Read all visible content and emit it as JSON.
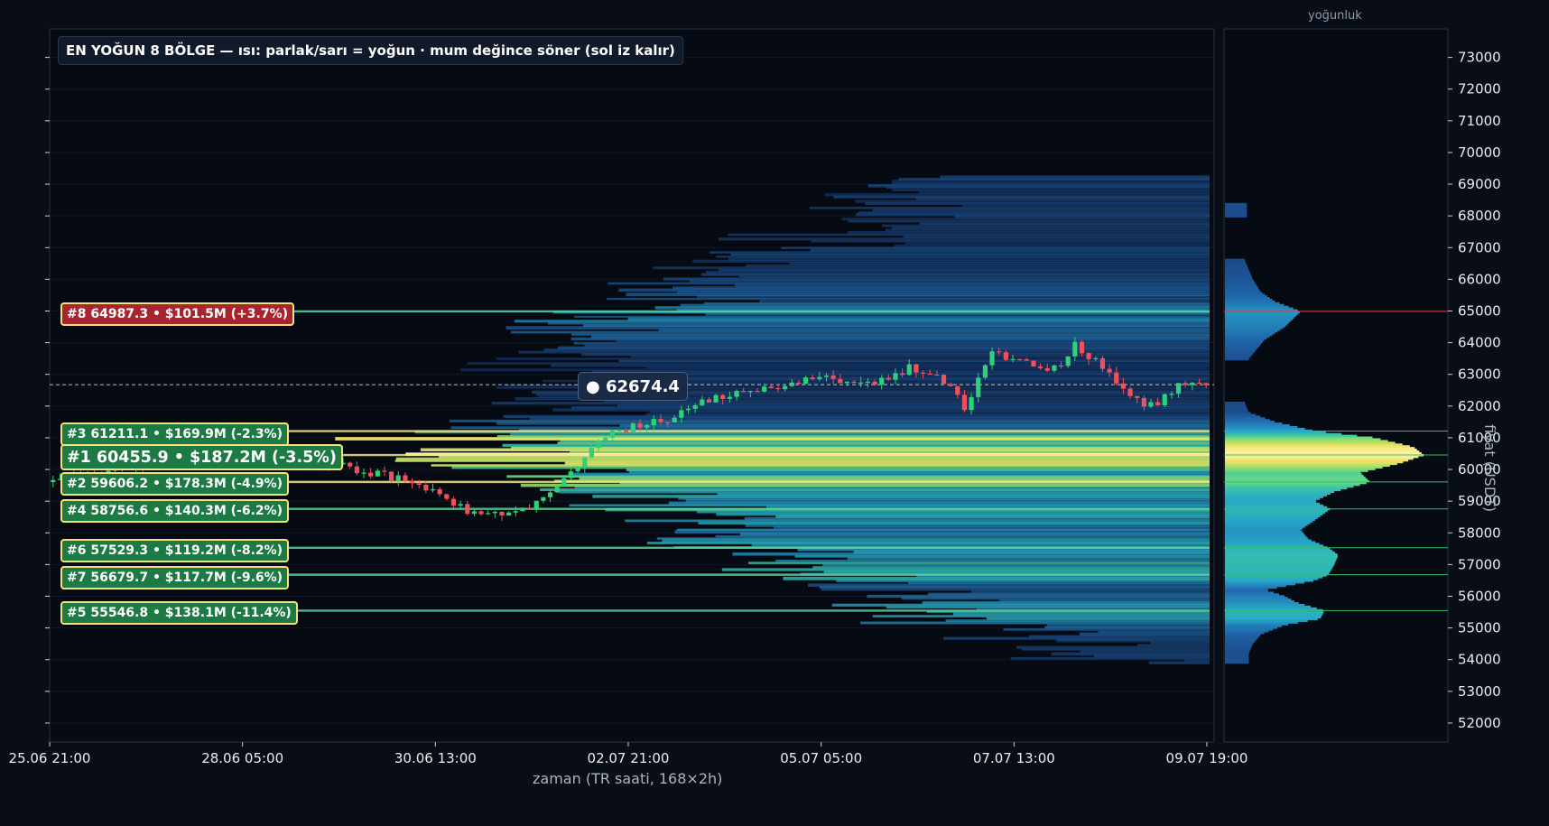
{
  "colors": {
    "background": "#080d16",
    "bull": "#2fd07a",
    "bear": "#f0505c",
    "zone_green": "#1e7a45",
    "zone_red": "#a8242f",
    "zone_border": "#f3e27a"
  },
  "chart_data": {
    "type": "heatmap",
    "title": "EN YOĞUN 8 BÖLGE — ısı: parlak/sarı = yoğun · mum değince söner (sol iz kalır)",
    "xlabel": "zaman (TR saati, 168×2h)",
    "ylabel": "fiyat (USDT)",
    "ylim": [
      51400,
      73900
    ],
    "x_ticks": [
      "25.06 21:00",
      "28.06 05:00",
      "30.06 13:00",
      "02.07 21:00",
      "05.07 05:00",
      "07.07 13:00",
      "09.07 19:00"
    ],
    "y_ticks": [
      52000,
      53000,
      54000,
      55000,
      56000,
      57000,
      58000,
      59000,
      60000,
      61000,
      62000,
      63000,
      64000,
      65000,
      66000,
      67000,
      68000,
      69000,
      70000,
      71000,
      72000,
      73000
    ],
    "candle_count": 168,
    "current_price": 62674.4,
    "current_price_label": "● 62674.4",
    "candle_path": [
      [
        0,
        59600
      ],
      [
        10,
        60100
      ],
      [
        20,
        60300
      ],
      [
        30,
        60500
      ],
      [
        40,
        60200
      ],
      [
        50,
        59700
      ],
      [
        55,
        59300
      ],
      [
        60,
        58700
      ],
      [
        63,
        58500
      ],
      [
        66,
        58700
      ],
      [
        70,
        58900
      ],
      [
        72,
        59300
      ],
      [
        74,
        59800
      ],
      [
        76,
        60200
      ],
      [
        78,
        60700
      ],
      [
        80,
        61000
      ],
      [
        84,
        61400
      ],
      [
        88,
        61500
      ],
      [
        92,
        61900
      ],
      [
        96,
        62300
      ],
      [
        100,
        62500
      ],
      [
        104,
        62600
      ],
      [
        108,
        62800
      ],
      [
        112,
        62900
      ],
      [
        116,
        62700
      ],
      [
        120,
        62800
      ],
      [
        124,
        63200
      ],
      [
        128,
        62900
      ],
      [
        130,
        62500
      ],
      [
        132,
        62000
      ],
      [
        134,
        62800
      ],
      [
        136,
        63600
      ],
      [
        140,
        63500
      ],
      [
        143,
        63200
      ],
      [
        146,
        63300
      ],
      [
        148,
        63900
      ],
      [
        150,
        63600
      ],
      [
        152,
        63200
      ],
      [
        154,
        62800
      ],
      [
        156,
        62200
      ],
      [
        158,
        62100
      ],
      [
        160,
        62000
      ],
      [
        162,
        62500
      ],
      [
        164,
        62700
      ],
      [
        167,
        62674.4
      ]
    ],
    "zones": [
      {
        "rank": 1,
        "label": "#1  60455.9  •  $187.2M  (-3.5%)",
        "price": 60455.9,
        "volume_musd": 187.2,
        "change_pct": -3.5,
        "color": "#1e7a45"
      },
      {
        "rank": 2,
        "label": "#2  59606.2  •  $178.3M  (-4.9%)",
        "price": 59606.2,
        "volume_musd": 178.3,
        "change_pct": -4.9,
        "color": "#1e7a45"
      },
      {
        "rank": 3,
        "label": "#3  61211.1  •  $169.9M  (-2.3%)",
        "price": 61211.1,
        "volume_musd": 169.9,
        "change_pct": -2.3,
        "color": "#1e7a45"
      },
      {
        "rank": 4,
        "label": "#4  58756.6  •  $140.3M  (-6.2%)",
        "price": 58756.6,
        "volume_musd": 140.3,
        "change_pct": -6.2,
        "color": "#1e7a45"
      },
      {
        "rank": 5,
        "label": "#5  55546.8  •  $138.1M  (-11.4%)",
        "price": 55546.8,
        "volume_musd": 138.1,
        "change_pct": -11.4,
        "color": "#1e7a45"
      },
      {
        "rank": 6,
        "label": "#6  57529.3  •  $119.2M  (-8.2%)",
        "price": 57529.3,
        "volume_musd": 119.2,
        "change_pct": -8.2,
        "color": "#1e7a45"
      },
      {
        "rank": 7,
        "label": "#7  56679.7  •  $117.7M  (-9.6%)",
        "price": 56679.7,
        "volume_musd": 117.7,
        "change_pct": -9.6,
        "color": "#1e7a45"
      },
      {
        "rank": 8,
        "label": "#8  64987.3  •  $101.5M  (+3.7%)",
        "price": 64987.3,
        "volume_musd": 101.5,
        "change_pct": 3.7,
        "color": "#a8242f"
      }
    ],
    "density_title": "yoğunluk",
    "density_profile": [
      [
        53900,
        0.12
      ],
      [
        54200,
        0.12
      ],
      [
        54500,
        0.14
      ],
      [
        54800,
        0.18
      ],
      [
        55100,
        0.3
      ],
      [
        55300,
        0.48
      ],
      [
        55546.8,
        0.5
      ],
      [
        55800,
        0.36
      ],
      [
        56000,
        0.3
      ],
      [
        56200,
        0.2
      ],
      [
        56500,
        0.45
      ],
      [
        56679.7,
        0.52
      ],
      [
        57000,
        0.55
      ],
      [
        57300,
        0.57
      ],
      [
        57529.3,
        0.52
      ],
      [
        57800,
        0.42
      ],
      [
        58100,
        0.38
      ],
      [
        58400,
        0.45
      ],
      [
        58756.6,
        0.53
      ],
      [
        59000,
        0.45
      ],
      [
        59300,
        0.55
      ],
      [
        59606.2,
        0.73
      ],
      [
        59900,
        0.68
      ],
      [
        60200,
        0.88
      ],
      [
        60455.9,
        1.0
      ],
      [
        60700,
        0.95
      ],
      [
        61000,
        0.75
      ],
      [
        61211.1,
        0.45
      ],
      [
        61500,
        0.25
      ],
      [
        61800,
        0.12
      ],
      [
        62100,
        0.1
      ],
      [
        63500,
        0.12
      ],
      [
        63800,
        0.16
      ],
      [
        64100,
        0.2
      ],
      [
        64500,
        0.3
      ],
      [
        64987.3,
        0.38
      ],
      [
        65300,
        0.25
      ],
      [
        65600,
        0.18
      ],
      [
        66000,
        0.14
      ],
      [
        66300,
        0.12
      ],
      [
        66600,
        0.1
      ],
      [
        68000,
        0.11
      ],
      [
        68400,
        0.11
      ]
    ]
  }
}
